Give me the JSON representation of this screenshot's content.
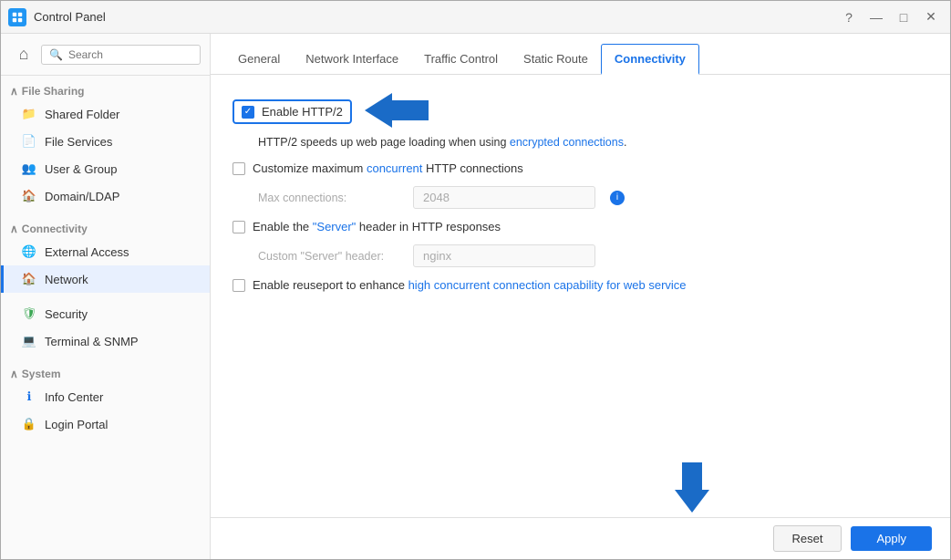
{
  "window": {
    "title": "Control Panel"
  },
  "title_bar_controls": {
    "help": "?",
    "minimize": "—",
    "maximize": "□",
    "close": "✕"
  },
  "sidebar": {
    "search_placeholder": "Search",
    "sections": [
      {
        "header": "File Sharing",
        "items": [
          {
            "id": "shared-folder",
            "label": "Shared Folder",
            "icon": "folder"
          },
          {
            "id": "file-services",
            "label": "File Services",
            "icon": "file-services"
          },
          {
            "id": "user-group",
            "label": "User & Group",
            "icon": "users"
          },
          {
            "id": "domain-ldap",
            "label": "Domain/LDAP",
            "icon": "domain"
          }
        ]
      },
      {
        "header": "Connectivity",
        "items": [
          {
            "id": "external-access",
            "label": "External Access",
            "icon": "external"
          },
          {
            "id": "network",
            "label": "Network",
            "icon": "network",
            "active": true
          }
        ]
      },
      {
        "header": "",
        "items": [
          {
            "id": "security",
            "label": "Security",
            "icon": "security"
          },
          {
            "id": "terminal-snmp",
            "label": "Terminal & SNMP",
            "icon": "terminal"
          }
        ]
      },
      {
        "header": "System",
        "items": [
          {
            "id": "info-center",
            "label": "Info Center",
            "icon": "info"
          },
          {
            "id": "login-portal",
            "label": "Login Portal",
            "icon": "login"
          }
        ]
      }
    ]
  },
  "tabs": [
    {
      "id": "general",
      "label": "General"
    },
    {
      "id": "network-interface",
      "label": "Network Interface"
    },
    {
      "id": "traffic-control",
      "label": "Traffic Control"
    },
    {
      "id": "static-route",
      "label": "Static Route"
    },
    {
      "id": "connectivity",
      "label": "Connectivity",
      "active": true
    }
  ],
  "panel": {
    "enable_http2": {
      "label": "Enable HTTP/2",
      "checked": true
    },
    "http2_desc": "HTTP/2 speeds up web page loading when using encrypted connections.",
    "customize_concurrent": {
      "label": "Customize maximum concurrent HTTP connections",
      "checked": false
    },
    "max_connections": {
      "label": "Max connections:",
      "value": "2048"
    },
    "enable_server_header": {
      "label_pre": "Enable the ",
      "label_quot": "\"Server\"",
      "label_post": " header in HTTP responses",
      "checked": false
    },
    "custom_server_header": {
      "label": "Custom \"Server\" header:",
      "value": "nginx"
    },
    "enable_reuseport": {
      "label_pre": "Enable reuseport to enhance high concurrent connection capability for web service",
      "checked": false
    }
  },
  "buttons": {
    "reset": "Reset",
    "apply": "Apply"
  }
}
